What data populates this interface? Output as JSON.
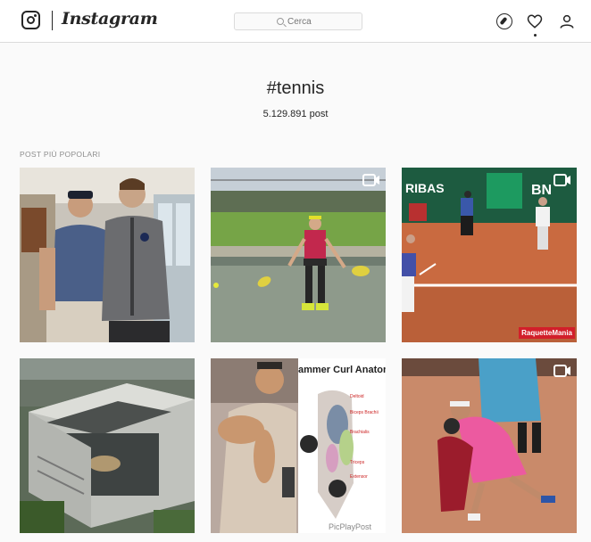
{
  "header": {
    "logo_word": "Instagram",
    "search": {
      "placeholder": "Cerca"
    }
  },
  "tag": {
    "name": "#tennis",
    "post_count": "5.129.891 post"
  },
  "section": {
    "title": "POST PIÙ POPOLARI"
  },
  "posts": [
    {
      "kind": "photo"
    },
    {
      "kind": "video"
    },
    {
      "kind": "video",
      "watermark": "RaquetteMania"
    },
    {
      "kind": "photo"
    },
    {
      "kind": "photo",
      "art_title": "ammer Curl Anatomy",
      "art_footer": "PicPlayPost"
    },
    {
      "kind": "video"
    }
  ],
  "icons": {
    "logo": "instagram-camera-icon",
    "search": "search-icon",
    "explore": "compass-icon",
    "activity": "heart-icon",
    "profile": "person-icon",
    "video": "video-camera-icon"
  },
  "colors": {
    "background": "#fafafa",
    "border": "#dbdbdb",
    "text": "#262626",
    "muted": "#8e8e8e"
  }
}
